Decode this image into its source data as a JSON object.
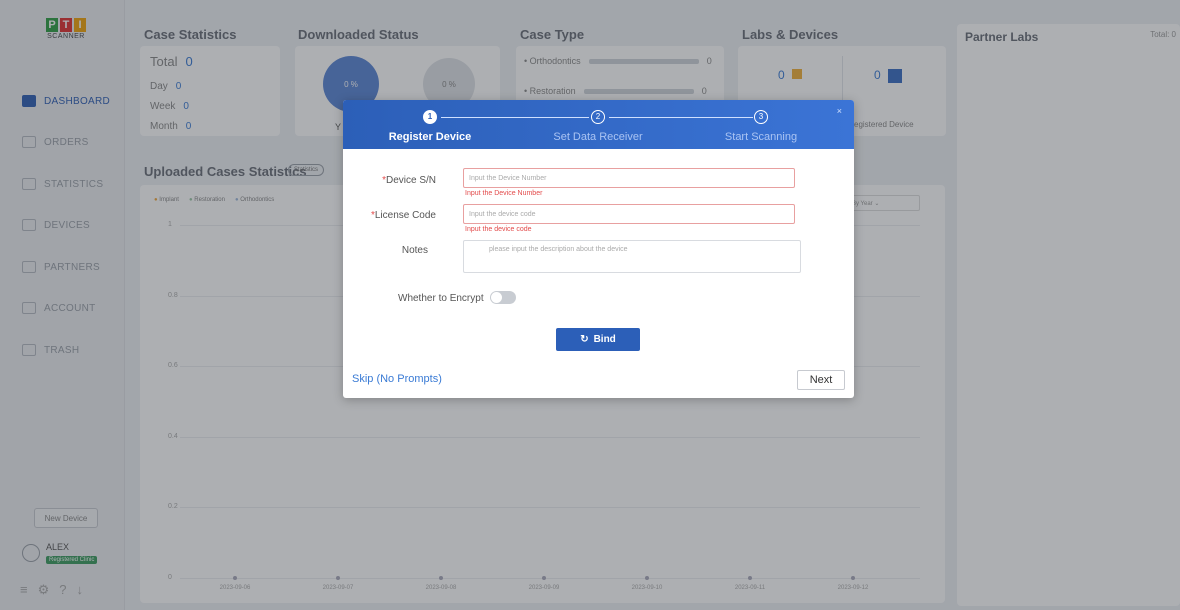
{
  "app": {
    "logo_text": "PTI",
    "logo_sub": "SCANNER"
  },
  "sidebar": {
    "items": [
      {
        "label": "DASHBOARD",
        "icon": "dashboard-icon"
      },
      {
        "label": "ORDERS",
        "icon": "orders-icon"
      },
      {
        "label": "STATISTICS",
        "icon": "statistics-icon"
      },
      {
        "label": "DEVICES",
        "icon": "devices-icon"
      },
      {
        "label": "PARTNERS",
        "icon": "partners-icon"
      },
      {
        "label": "ACCOUNT",
        "icon": "account-icon"
      },
      {
        "label": "TRASH",
        "icon": "trash-icon"
      }
    ],
    "new_device": "New Device",
    "user": {
      "name": "ALEX",
      "badge": "Registered Clinic"
    }
  },
  "case_statistics": {
    "title": "Case Statistics",
    "total_label": "Total",
    "total": "0",
    "day_label": "Day",
    "day": "0",
    "week_label": "Week",
    "week": "0",
    "month_label": "Month",
    "month": "0"
  },
  "downloaded_status": {
    "title": "Downloaded Status",
    "pct1": "0 %",
    "pct2": "0 %",
    "label_y": "Y"
  },
  "case_type": {
    "title": "Case Type",
    "items": [
      {
        "label": "Orthodontics",
        "value": "0"
      },
      {
        "label": "Restoration",
        "value": "0"
      }
    ]
  },
  "labs_devices": {
    "title": "Labs & Devices",
    "labs": "0",
    "devices": "0",
    "registered_label": "egistered Device"
  },
  "partner_labs": {
    "title": "Partner Labs",
    "total_label": "Total: 0"
  },
  "uploaded": {
    "title": "Uploaded Cases Statistics",
    "tab": "Statistics",
    "legend": [
      "Implant",
      "Restoration",
      "Orthodontics"
    ],
    "range_select": "By Year"
  },
  "chart_data": {
    "type": "line",
    "x": [
      "2023-09-06",
      "2023-09-07",
      "2023-09-08",
      "2023-09-09",
      "2023-09-10",
      "2023-09-11",
      "2023-09-12"
    ],
    "series": [
      {
        "values": [
          0,
          0,
          0,
          0,
          0,
          0,
          0
        ]
      }
    ],
    "yticks": [
      "1",
      "0.8",
      "0.6",
      "0.4",
      "0.2",
      "0"
    ],
    "ylim": [
      0,
      1
    ]
  },
  "modal": {
    "steps": [
      {
        "num": "1",
        "label": "Register Device"
      },
      {
        "num": "2",
        "label": "Set Data Receiver"
      },
      {
        "num": "3",
        "label": "Start Scanning"
      }
    ],
    "close": "×",
    "device_sn_label": "Device S/N",
    "device_sn_placeholder": "Input the Device Number",
    "device_sn_error": "Input the Device Number",
    "license_label": "License Code",
    "license_placeholder": "Input the device code",
    "license_error": "Input the device code",
    "notes_label": "Notes",
    "notes_placeholder": "please input the description about the device",
    "encrypt_label": "Whether to Encrypt",
    "bind_label": "Bind",
    "skip_label": "Skip (No Prompts)",
    "next_label": "Next"
  }
}
